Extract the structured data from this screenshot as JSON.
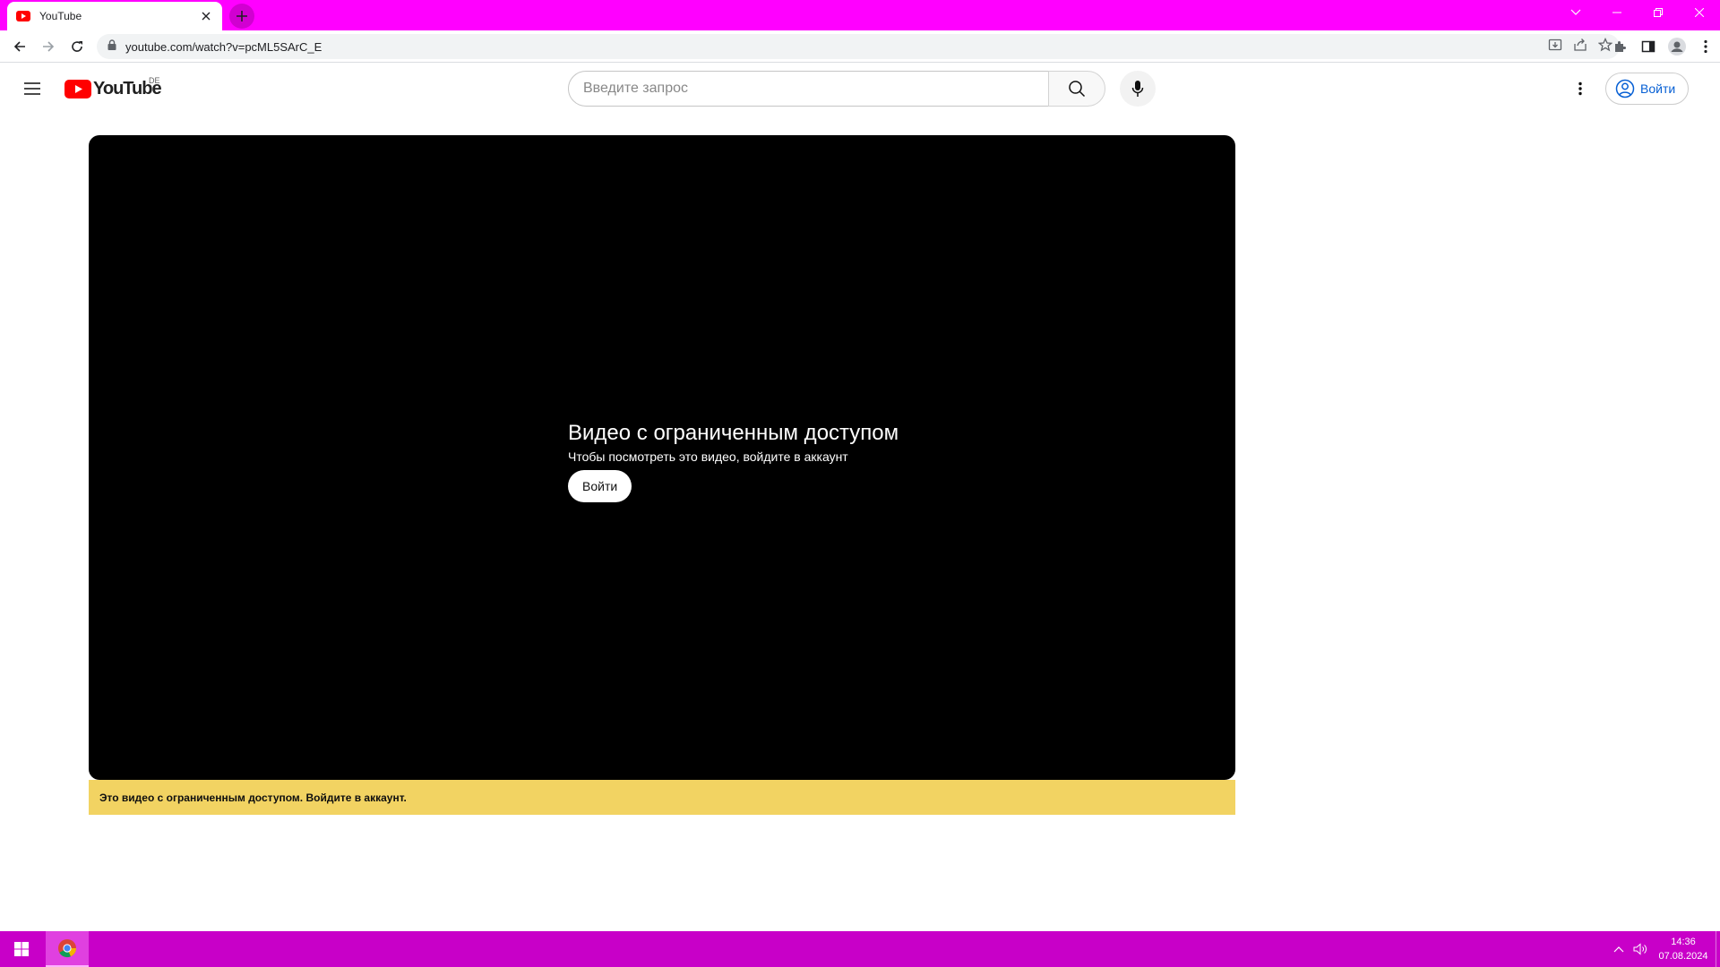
{
  "browser": {
    "tab_title": "YouTube",
    "url": "youtube.com/watch?v=pcML5SArC_E"
  },
  "masthead": {
    "logo_text": "YouTube",
    "country_code": "DE",
    "search_placeholder": "Введите запрос",
    "signin_label": "Войти"
  },
  "player": {
    "error_title": "Видео с ограниченным доступом",
    "error_subtitle": "Чтобы посмотреть это видео, войдите в аккаунт",
    "signin_label": "Войти"
  },
  "notice": {
    "text": "Это видео с ограниченным доступом. Войдите в аккаунт."
  },
  "taskbar": {
    "time": "14:36",
    "date": "07.08.2024"
  },
  "colors": {
    "tabbar": "#ff00ff",
    "taskbar": "#c800c8",
    "youtube_red": "#ff0000",
    "notice_bg": "#f2d362",
    "link_blue": "#065fd4"
  }
}
